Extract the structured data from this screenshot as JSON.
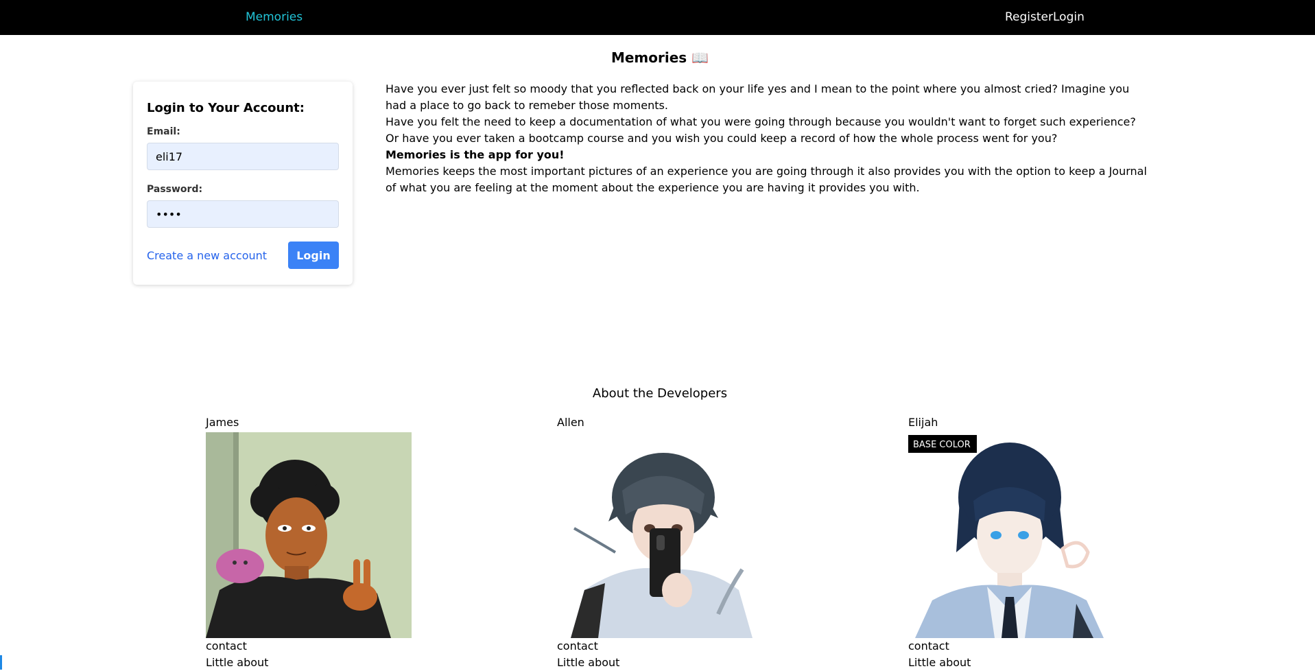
{
  "nav": {
    "brand": "Memories",
    "register": "Register",
    "login": "Login"
  },
  "page": {
    "title": "Memories 📖"
  },
  "login_card": {
    "title": "Login to Your Account:",
    "email_label": "Email:",
    "email_value": "eli17",
    "password_label": "Password:",
    "password_value": "••••",
    "create_link": "Create a new account",
    "login_button": "Login"
  },
  "intro": {
    "p1": "Have you ever just felt so moody that you reflected back on your life yes and I mean to the point where you almost cried? Imagine you had a place to go back to remeber those moments.",
    "p2": "Have you felt the need to keep a documentation of what you were going through because you wouldn't want to forget such experience?",
    "p3": "Or have you ever taken a bootcamp course and you wish you could keep a record of how the whole process went for you?",
    "p4": "Memories is the app for you!",
    "p5": "Memories keeps the most important pictures of an experience you are going through it also provides you with the option to keep a Journal of what you are feeling at the moment about the experience you are having it provides you with."
  },
  "developers": {
    "heading": "About the Developers",
    "items": [
      {
        "name": "James",
        "contact": "contact",
        "about": "Little about"
      },
      {
        "name": "Allen",
        "contact": "contact",
        "about": "Little about"
      },
      {
        "name": "Elijah",
        "contact": "contact",
        "about": "Little about",
        "badge": "BASE COLOR"
      }
    ]
  },
  "colors": {
    "nav_bg": "#000000",
    "brand": "#22c5d9",
    "link": "#2563eb",
    "button": "#3b82f6",
    "input_bg": "#e8f0fe"
  }
}
